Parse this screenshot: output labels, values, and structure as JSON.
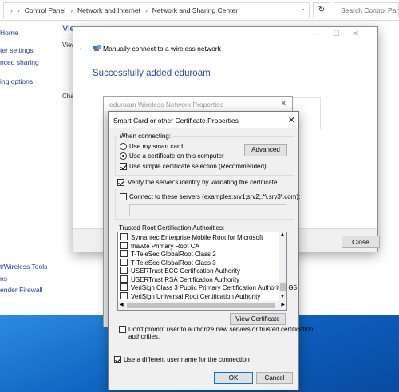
{
  "explorer": {
    "breadcrumb": [
      "Control Panel",
      "Network and Internet",
      "Network and Sharing Center"
    ],
    "search_placeholder": "Search Control Pan",
    "left_links": [
      "Home",
      "ter settings",
      "nced sharing",
      "ing options",
      "t/Wireless Tools",
      "ns",
      "ender Firewall"
    ],
    "heading_fragment": "Vie",
    "view_fragment": "View",
    "change_fragment": "Chan"
  },
  "wizard": {
    "title": "Manually connect to a wireless network",
    "heading": "Successfully added eduroam",
    "close_label": "Close"
  },
  "eduroam": {
    "title": "eduroam Wireless Network Properties"
  },
  "smartcard": {
    "title": "Smart Card or other Certificate Properties",
    "when_connecting": "When connecting:",
    "use_smart_card": "Use my smart card",
    "use_certificate": "Use a certificate on this computer",
    "simple_selection": "Use simple certificate selection (Recommended)",
    "advanced": "Advanced",
    "verify_identity": "Verify the server's identity by validating the certificate",
    "connect_servers": "Connect to these servers (examples:srv1;srv2;.*\\.srv3\\.com):",
    "trusted_root": "Trusted Root Certification Authorities:",
    "ca_list": [
      {
        "name": "Symantec Enterprise Mobile Root for Microsoft",
        "checked": false
      },
      {
        "name": "thawte Primary Root CA",
        "checked": false
      },
      {
        "name": "T-TeleSec GlobalRoot Class 2",
        "checked": false
      },
      {
        "name": "T-TeleSec GlobalRoot Class 3",
        "checked": false
      },
      {
        "name": "USERTrust ECC Certification Authority",
        "checked": false
      },
      {
        "name": "USERTrust RSA Certification Authority",
        "checked": false
      },
      {
        "name": "VeriSign Class 3 Public Primary Certification Authority - G5",
        "checked": false
      },
      {
        "name": "VeriSign Universal Root Certification Authority",
        "checked": false
      }
    ],
    "view_certificate": "View Certificate",
    "dont_prompt": "Don't prompt user to authorize new servers or trusted certification",
    "dont_prompt_2": "authorities.",
    "different_user": "Use a different user name for the connection",
    "ok": "OK",
    "cancel": "Cancel"
  },
  "colors": {
    "link": "#1c3d9a",
    "heading": "#1b4fa3",
    "accent": "#0078d7"
  }
}
